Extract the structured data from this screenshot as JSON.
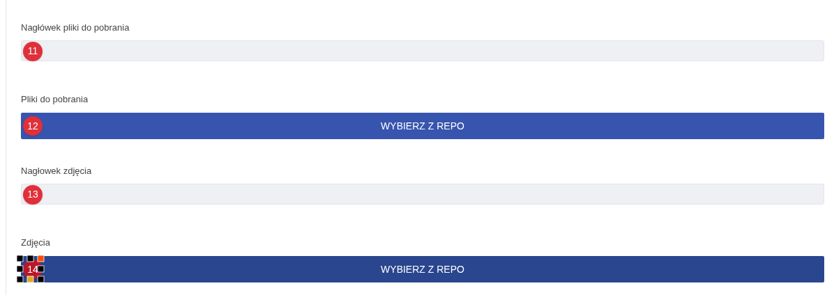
{
  "sections": [
    {
      "label": "Nagłówek pliki do pobrania",
      "kind": "field",
      "marker": {
        "number": "11",
        "selected": false
      }
    },
    {
      "label": "Pliki do pobrania",
      "kind": "button",
      "button": "WYBIERZ Z REPO",
      "hovered": false,
      "marker": {
        "number": "12",
        "selected": false
      }
    },
    {
      "label": "Nagłowek zdjęcia",
      "kind": "field",
      "marker": {
        "number": "13",
        "selected": false
      }
    },
    {
      "label": "Zdjęcia",
      "kind": "button",
      "button": "WYBIERZ Z REPO",
      "hovered": true,
      "marker": {
        "number": "14",
        "selected": true
      }
    }
  ]
}
